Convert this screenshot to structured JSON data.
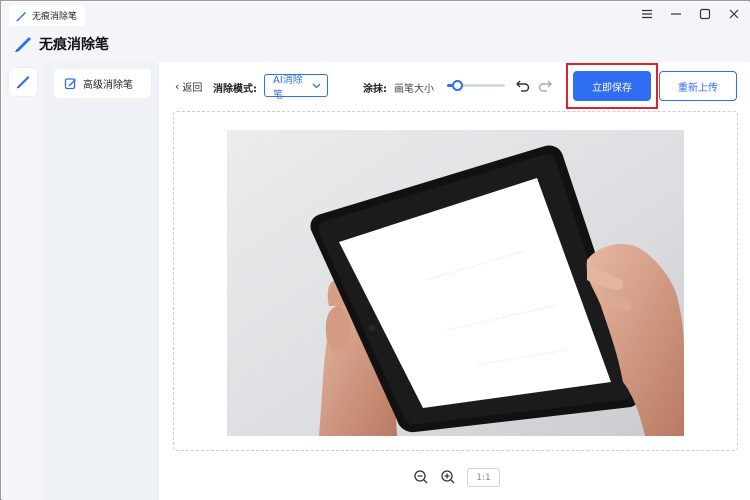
{
  "window": {
    "tab_title": "无痕消除笔"
  },
  "header": {
    "app_title": "无痕消除笔"
  },
  "sidemenu": {
    "items": [
      {
        "label": "高级消除笔"
      }
    ]
  },
  "toolbar": {
    "back_label": "返回",
    "mode_label": "消除模式:",
    "mode_value": "AI消除笔",
    "erase_label": "涂抹:",
    "brush_size_label": "画笔大小",
    "brush_size_fraction": 0.18,
    "save_label": "立即保存",
    "reupload_label": "重新上传"
  },
  "zoom": {
    "reset_label": "1:1"
  },
  "colors": {
    "accent": "#2f6df2",
    "highlight": "#e0202e",
    "chrome_bg": "#f3f5f8"
  },
  "icons": {
    "logo": "eraser-pen-icon",
    "menu": "edit-icon",
    "undo": "undo-icon",
    "redo": "redo-icon",
    "zoom_out": "zoom-out-icon",
    "zoom_in": "zoom-in-icon"
  }
}
